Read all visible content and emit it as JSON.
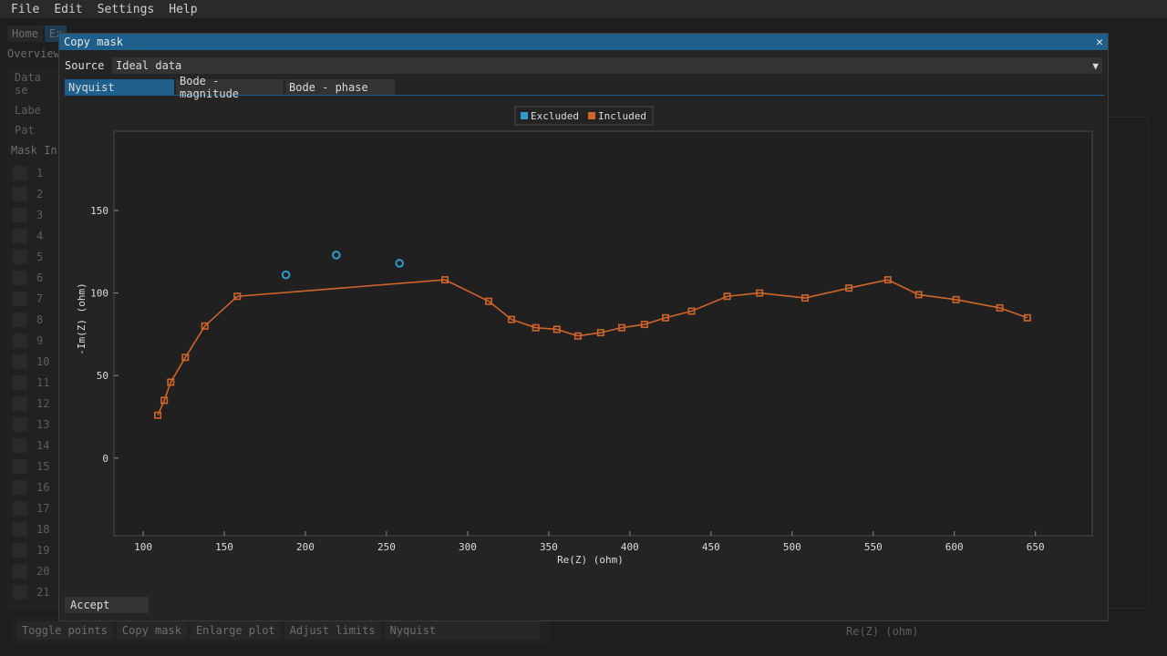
{
  "menu": {
    "items": [
      "File",
      "Edit",
      "Settings",
      "Help"
    ]
  },
  "background": {
    "tabs": [
      "Home",
      "Ex"
    ],
    "subtab": "Overview",
    "panel_labels": [
      "Data se",
      "Labe",
      "Pat"
    ],
    "table_header": "Mask In",
    "row_numbers": [
      "1",
      "2",
      "3",
      "4",
      "5",
      "6",
      "7",
      "8",
      "9",
      "10",
      "11",
      "12",
      "13",
      "14",
      "15",
      "16",
      "17",
      "18",
      "19",
      "20",
      "21"
    ],
    "bottom_buttons": [
      "Toggle points",
      "Copy mask",
      "Enlarge plot",
      "Adjust limits"
    ],
    "bottom_combo": "Nyquist",
    "plot_xlabel": "Re(Z) (ohm)"
  },
  "dialog": {
    "title": "Copy mask",
    "close_icon": "close-icon",
    "source_label": "Source",
    "source_value": "Ideal data",
    "tabs": [
      "Nyquist",
      "Bode - magnitude",
      "Bode - phase"
    ],
    "active_tab": "Nyquist",
    "accept_label": "Accept"
  },
  "colors": {
    "accent": "#1f5f8b",
    "excluded": "#2e9ccd",
    "included": "#d0652a"
  },
  "chart_data": {
    "type": "scatter",
    "xlabel": "Re(Z) (ohm)",
    "ylabel": "-Im(Z) (ohm)",
    "xlim": [
      82,
      685
    ],
    "ylim": [
      -47,
      198
    ],
    "xticks": [
      100,
      150,
      200,
      250,
      300,
      350,
      400,
      450,
      500,
      550,
      600,
      650
    ],
    "yticks": [
      0,
      50,
      100,
      150
    ],
    "legend": [
      "Excluded",
      "Included"
    ],
    "legend_position": "top-center",
    "series": [
      {
        "name": "Excluded",
        "marker": "circle",
        "line": false,
        "x": [
          188,
          219,
          258
        ],
        "y": [
          111,
          123,
          118
        ]
      },
      {
        "name": "Included",
        "marker": "square",
        "line": true,
        "x": [
          109,
          113,
          117,
          126,
          138,
          158,
          286,
          313,
          327,
          342,
          355,
          368,
          382,
          395,
          409,
          422,
          438,
          460,
          480,
          508,
          535,
          559,
          578,
          601,
          628,
          645
        ],
        "y": [
          26,
          35,
          46,
          61,
          80,
          98,
          108,
          95,
          84,
          79,
          78,
          74,
          76,
          79,
          81,
          85,
          89,
          98,
          100,
          97,
          103,
          108,
          99,
          96,
          91,
          85
        ]
      }
    ]
  }
}
